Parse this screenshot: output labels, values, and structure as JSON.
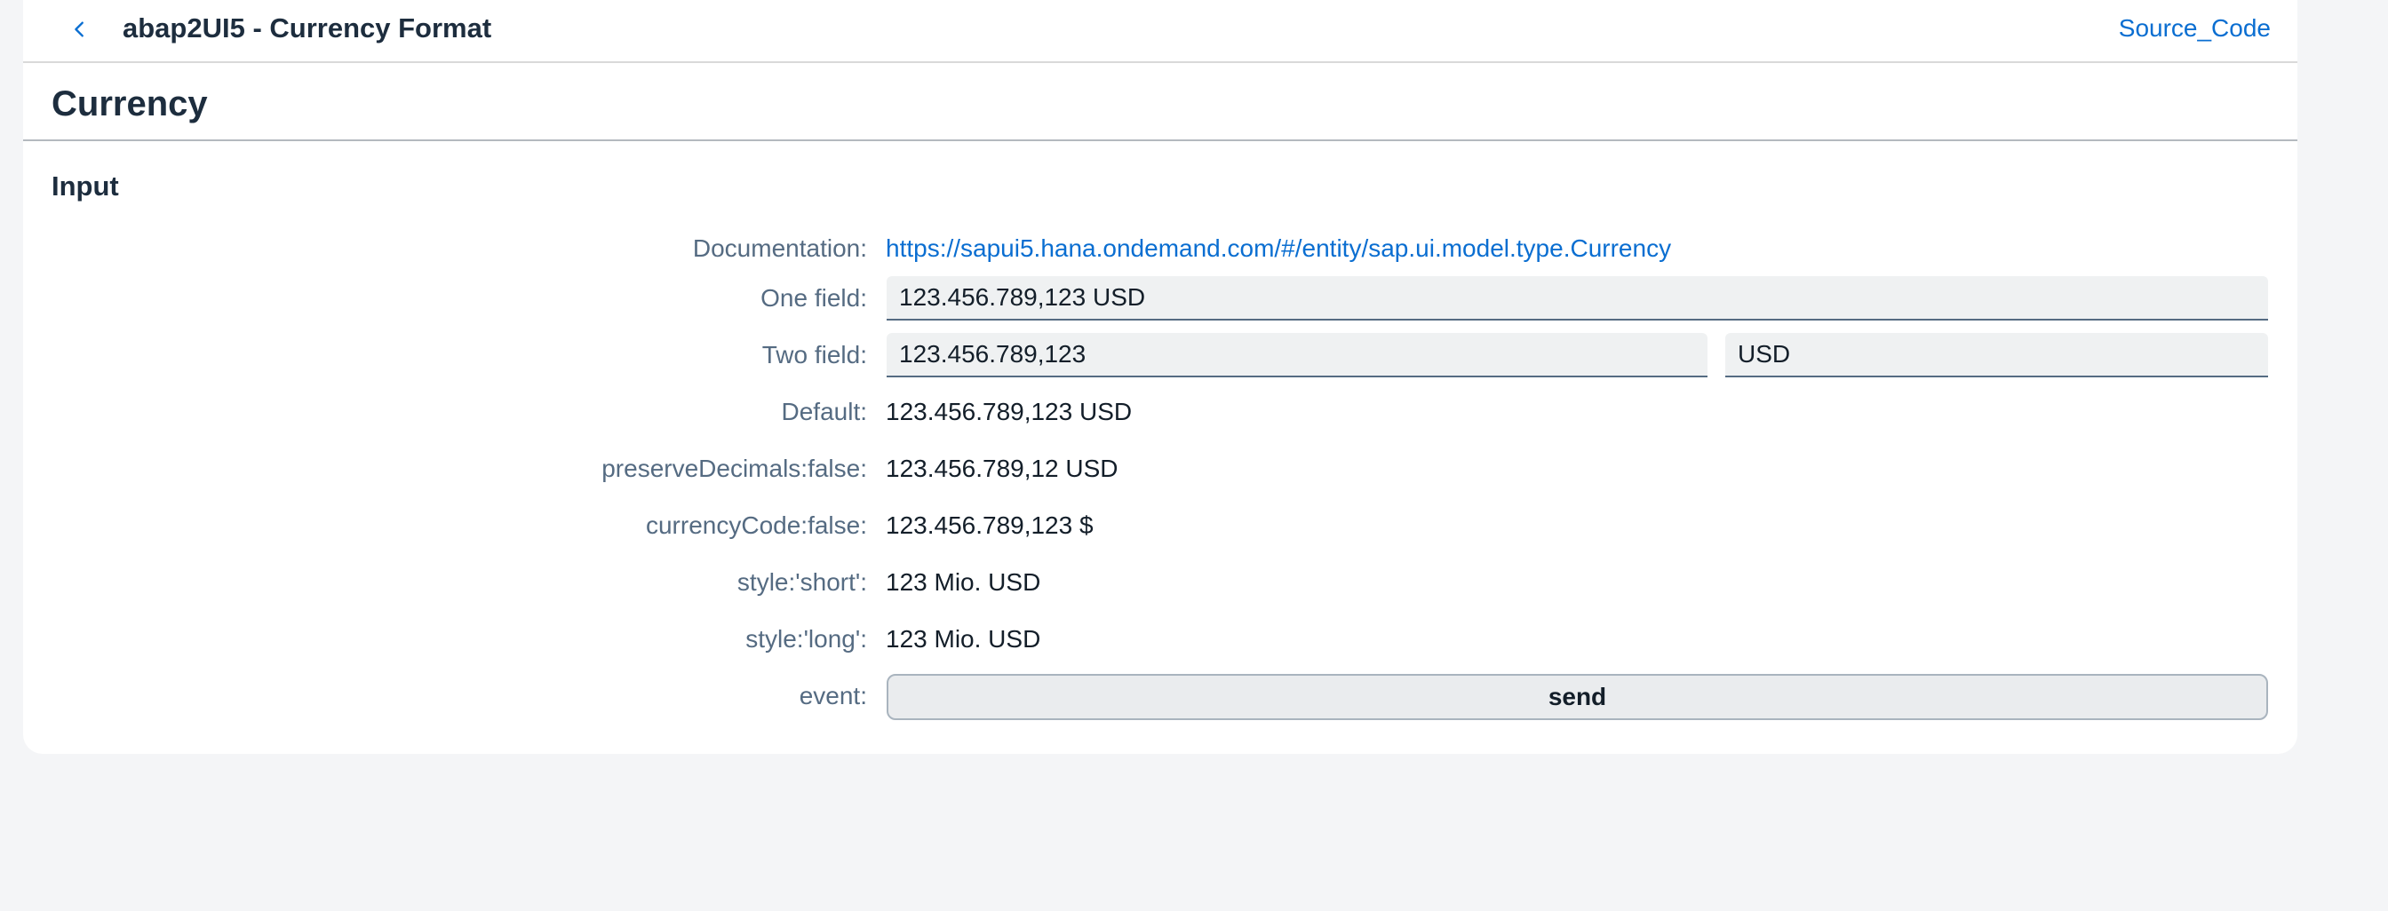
{
  "header": {
    "title": "abap2UI5 - Currency Format",
    "source_link": "Source_Code"
  },
  "page": {
    "title": "Currency"
  },
  "section": {
    "title": "Input"
  },
  "form": {
    "documentation": {
      "label": "Documentation:",
      "link": "https://sapui5.hana.ondemand.com/#/entity/sap.ui.model.type.Currency"
    },
    "one_field": {
      "label": "One field:",
      "value": "123.456.789,123 USD"
    },
    "two_field": {
      "label": "Two field:",
      "amount": "123.456.789,123",
      "currency": "USD"
    },
    "default": {
      "label": "Default:",
      "value": "123.456.789,123 USD"
    },
    "preserve_decimals": {
      "label": "preserveDecimals:false:",
      "value": "123.456.789,12 USD"
    },
    "currency_code": {
      "label": "currencyCode:false:",
      "value": "123.456.789,123 $"
    },
    "style_short": {
      "label": "style:'short':",
      "value": "123 Mio. USD"
    },
    "style_long": {
      "label": "style:'long':",
      "value": "123 Mio. USD"
    },
    "event": {
      "label": "event:",
      "button": "send"
    }
  },
  "colors": {
    "link": "#0a6ed1",
    "label": "#556b82",
    "text": "#131e29",
    "background": "#f4f5f7"
  },
  "icons": {
    "back": "chevron-left-icon"
  }
}
